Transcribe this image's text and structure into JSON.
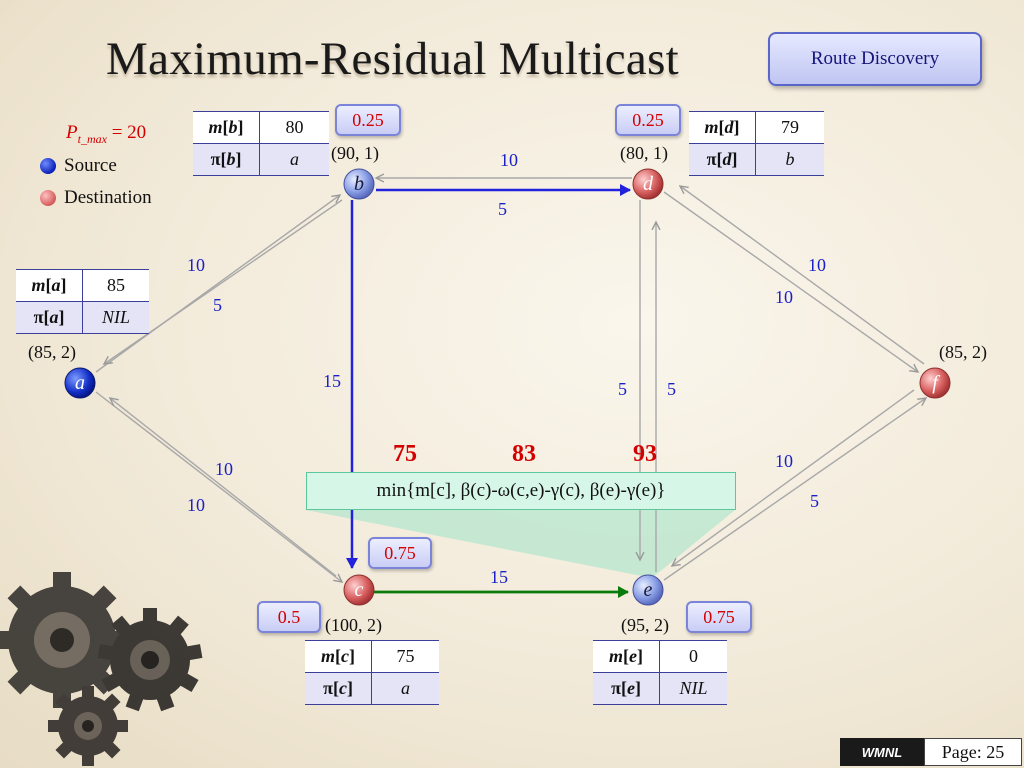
{
  "title": "Maximum-Residual Multicast",
  "route_button": "Route Discovery",
  "legend": {
    "p_letter": "P",
    "p_sub": "t_max",
    "p_value": "= 20",
    "source": "Source",
    "destination": "Destination"
  },
  "nodes": {
    "a": {
      "label": "a",
      "coord": "(85, 2)",
      "m_key": "m",
      "pi_key": "π",
      "m_val": "85",
      "pi_val": "NIL"
    },
    "b": {
      "label": "b",
      "coord": "(90, 1)",
      "m_key": "m",
      "pi_key": "π",
      "m_val": "80",
      "pi_val": "a",
      "badge": "0.25"
    },
    "c": {
      "label": "c",
      "coord": "(100, 2)",
      "m_key": "m",
      "pi_key": "π",
      "m_val": "75",
      "pi_val": "a",
      "badge": "0.5",
      "badge2": "0.75"
    },
    "d": {
      "label": "d",
      "coord": "(80, 1)",
      "m_key": "m",
      "pi_key": "π",
      "m_val": "79",
      "pi_val": "b",
      "badge": "0.25"
    },
    "e": {
      "label": "e",
      "coord": "(95, 2)",
      "m_key": "m",
      "pi_key": "π",
      "m_val": "0",
      "pi_val": "NIL",
      "badge": "0.75"
    },
    "f": {
      "label": "f",
      "coord": "(85, 2)"
    }
  },
  "edge_weights": {
    "bd_top": "10",
    "bd_bottom": "5",
    "ab_upper": "10",
    "ab_lower": "5",
    "df_upper": "10",
    "df_lower": "10",
    "bc": "15",
    "de_left": "5",
    "de_right": "5",
    "ac_upper": "10",
    "ac_lower": "10",
    "ef_upper": "10",
    "ef_lower": "5",
    "ce": "15"
  },
  "terms": [
    "75",
    "83",
    "93"
  ],
  "formula": "min{m[c], β(c)-ω(c,e)-γ(c), β(e)-γ(e)}",
  "footer": {
    "brand": "WMNL",
    "page": "Page: 25"
  },
  "colors": {
    "source": "#0a1fb5",
    "destination": "#d45a5a",
    "accent": "#d40000",
    "path_blue": "#2222dd",
    "path_green": "#0a7a0a"
  }
}
